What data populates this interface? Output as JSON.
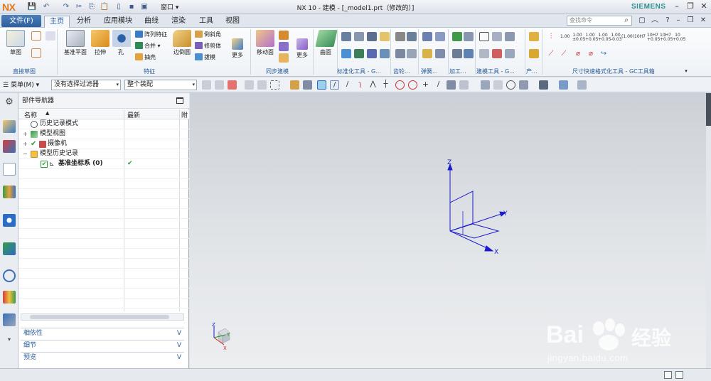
{
  "titlebar": {
    "logo": "NX",
    "window_menu": "窗口",
    "title": "NX 10 - 建模 - [_model1.prt（修改的）]",
    "brand": "SIEMENS"
  },
  "menubar": {
    "file_label": "文件(F)",
    "tabs": [
      "主页",
      "分析",
      "应用模块",
      "曲线",
      "渲染",
      "工具",
      "视图"
    ],
    "active_tab": "主页",
    "search_placeholder": "查找命令"
  },
  "ribbon": {
    "groups": {
      "direct_sketch": "直接草图",
      "feature": "特征",
      "sync_model": "同步建模",
      "std_tools": "标准化工具 - G...",
      "gear": "齿轮...",
      "spring": "弹簧...",
      "machining": "加工...",
      "modeling_tools": "建模工具 - G...",
      "more": "产...",
      "dim": "尺寸快速格式化工具 - GC工具箱"
    },
    "buttons": {
      "sketch": "草图",
      "datum_plane": "基准平面",
      "extrude": "拉伸",
      "hole": "孔",
      "pattern_feature": "阵列特征",
      "unite": "合并",
      "shell": "抽壳",
      "edge_blend": "边倒圆",
      "chamfer": "倒斜角",
      "trim_body": "修剪体",
      "draft": "拔模",
      "more1": "更多",
      "move_face": "移动面",
      "more2": "更多",
      "surface": "曲面"
    },
    "dim_labels": [
      "1.00",
      "1.00\n±0.05",
      "1.00\n+0.05",
      "1.00\n+0.05",
      "1.00\n-0.03",
      "(1.00)",
      "10H7",
      "10H7\n+0.05",
      "10H7\n+0.05",
      "10\n+0.05"
    ]
  },
  "toolbar2": {
    "menu": "菜单(M)",
    "filter": "没有选择过滤器",
    "assembly": "整个装配"
  },
  "navigator": {
    "title": "部件导航器",
    "col_name": "名称",
    "col_latest": "最新",
    "col_third": "附",
    "rows": [
      {
        "label": "历史记录模式",
        "latest": ""
      },
      {
        "label": "模型视图",
        "latest": ""
      },
      {
        "label": "摄像机",
        "latest": ""
      },
      {
        "label": "模型历史记录",
        "latest": ""
      },
      {
        "label": "基准坐标系 (0)",
        "latest": "✔"
      }
    ],
    "panels": [
      "相依性",
      "细节",
      "预览"
    ]
  },
  "graphics": {
    "axis_z": "Z",
    "axis_y": "Y",
    "axis_x": "X",
    "triad_z": "Z",
    "triad_y": "Y",
    "triad_x": "X"
  },
  "watermark": {
    "brand": "Bai",
    "brand2": "经验",
    "url": "jingyan.baidu.com"
  },
  "colors": {
    "accent": "#2d5f9b",
    "csys": "#1a1acc",
    "triad_x": "#d42020",
    "triad_y": "#1a9a1a"
  }
}
